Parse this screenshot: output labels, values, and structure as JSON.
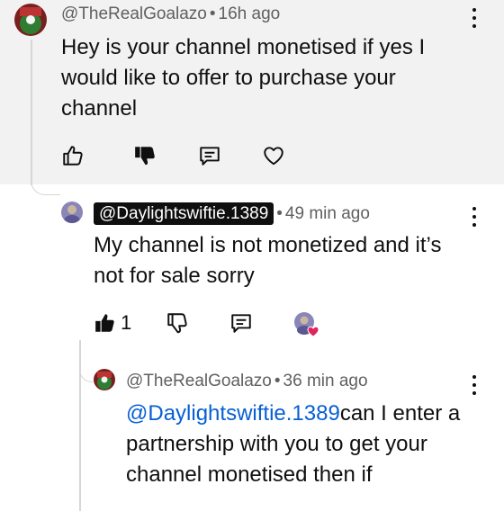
{
  "comments": [
    {
      "author": "@TheRealGoalazo",
      "time": "16h ago",
      "text": "Hey is your channel monetised if yes I would like to offer to purchase your channel",
      "icons": [
        "like-outline-icon",
        "dislike-filled-icon",
        "reply-icon",
        "heart-outline-icon"
      ]
    },
    {
      "author": "@Daylightswiftie.1389",
      "time": "49 min ago",
      "text": "My channel is not monetized and it’s not for sale sorry",
      "like_count": "1",
      "icons": [
        "like-filled-icon",
        "dislike-outline-icon",
        "reply-icon",
        "creator-heart-icon"
      ]
    },
    {
      "author": "@TheRealGoalazo",
      "time": "36 min ago",
      "mention": "@Daylightswiftie.1389",
      "text": "can I enter a partnership with you to get your channel monetised then if"
    }
  ],
  "separator": "•",
  "colors": {
    "background": "#ffffff",
    "highlight": "#f2f2f2",
    "mention": "#065fd4",
    "muted": "#606060",
    "heart": "#e0245e"
  }
}
